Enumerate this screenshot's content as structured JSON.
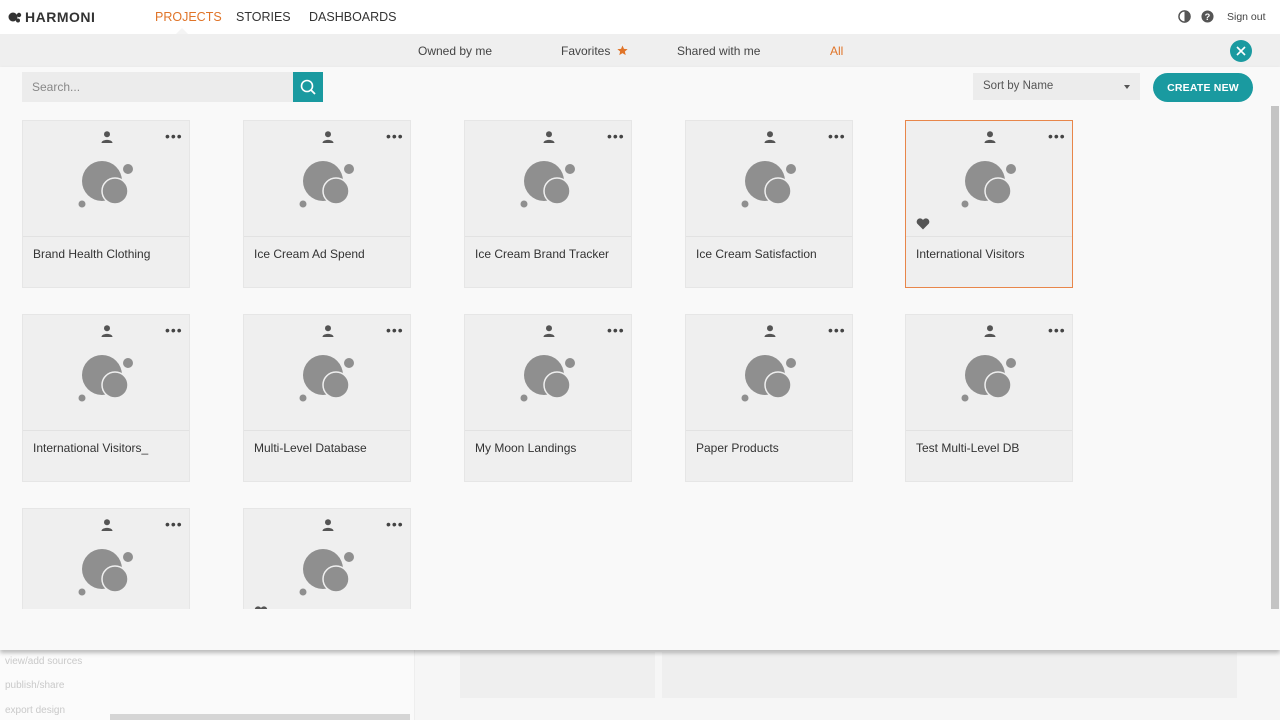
{
  "app": {
    "logo_text": "HARMONI",
    "nav": [
      {
        "label": "PROJECTS",
        "active": true
      },
      {
        "label": "STORIES",
        "active": false
      },
      {
        "label": "DASHBOARDS",
        "active": false
      }
    ],
    "sign_out": "Sign out",
    "icons": {
      "theme": "contrast-icon",
      "help": "help-icon"
    },
    "colors": {
      "accent": "#e07428",
      "teal": "#1a9aa0"
    }
  },
  "filters": {
    "owned": "Owned by me",
    "favorites": "Favorites",
    "shared": "Shared with me",
    "all": "All",
    "active": "All"
  },
  "toolbar": {
    "search_placeholder": "Search...",
    "sort_label": "Sort by Name",
    "create_label": "CREATE NEW"
  },
  "projects": [
    {
      "title": "Brand Health Clothing",
      "favorite": false,
      "selected": false
    },
    {
      "title": "Ice Cream Ad Spend",
      "favorite": false,
      "selected": false
    },
    {
      "title": "Ice Cream Brand Tracker",
      "favorite": false,
      "selected": false
    },
    {
      "title": "Ice Cream Satisfaction",
      "favorite": false,
      "selected": false
    },
    {
      "title": "International Visitors",
      "favorite": true,
      "selected": true
    },
    {
      "title": "International Visitors_",
      "favorite": false,
      "selected": false
    },
    {
      "title": "Multi-Level Database",
      "favorite": false,
      "selected": false
    },
    {
      "title": "My Moon Landings",
      "favorite": false,
      "selected": false
    },
    {
      "title": "Paper Products",
      "favorite": false,
      "selected": false
    },
    {
      "title": "Test Multi-Level DB",
      "favorite": false,
      "selected": false
    },
    {
      "title": "",
      "favorite": false,
      "selected": false
    },
    {
      "title": "",
      "favorite": true,
      "selected": false
    }
  ],
  "background": {
    "sidebar_items": [
      "view/add sources",
      "publish/share",
      "export design"
    ]
  }
}
